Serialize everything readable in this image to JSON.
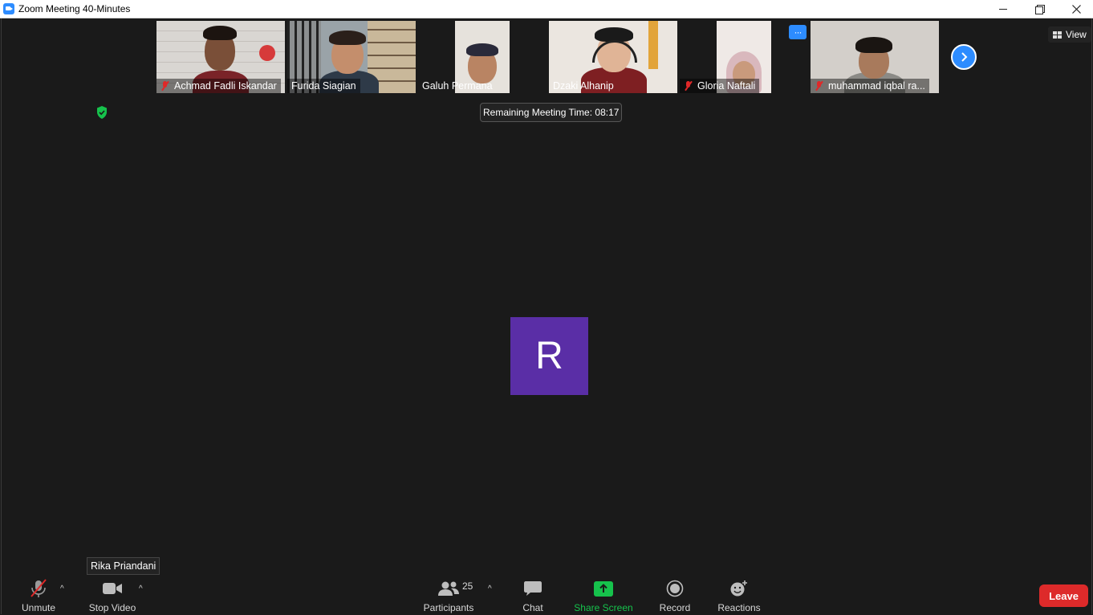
{
  "window": {
    "title": "Zoom Meeting 40-Minutes"
  },
  "view": {
    "label": "View"
  },
  "timer": {
    "label": "Remaining Meeting Time: 08:17"
  },
  "more_label": "···",
  "participants_strip": [
    {
      "name": "Achmad Fadli Iskandar",
      "muted": true
    },
    {
      "name": "Furida Siagian",
      "muted": false
    },
    {
      "name": "Galuh Permana",
      "muted": false
    },
    {
      "name": "Dzaki Alhanip",
      "muted": false
    },
    {
      "name": "Gloria Naftali",
      "muted": true
    },
    {
      "name": "muhammad iqbal ra...",
      "muted": true
    }
  ],
  "active_speaker": {
    "initial": "R",
    "name": "Rika Priandani",
    "avatar_color": "#5a2ea6"
  },
  "toolbar": {
    "unmute": "Unmute",
    "stop_video": "Stop Video",
    "participants": "Participants",
    "participants_count": "25",
    "chat": "Chat",
    "share_screen": "Share Screen",
    "record": "Record",
    "reactions": "Reactions",
    "leave": "Leave",
    "caret": "^"
  },
  "colors": {
    "background": "#1a1a1a",
    "accent": "#2d8cff",
    "share_green": "#16c24c",
    "leave_red": "#dd2a2a",
    "muted_red": "#e02828"
  }
}
